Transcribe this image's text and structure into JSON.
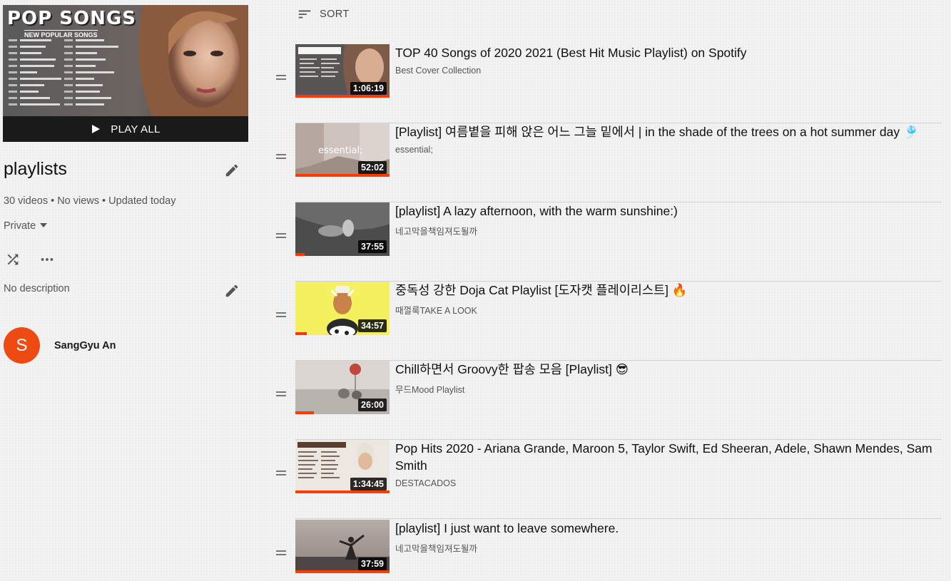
{
  "sidebar": {
    "hero": {
      "art_title": "POP SONGS",
      "art_subtitle": "NEW POPULAR SONGS",
      "play_all_label": "PLAY ALL"
    },
    "title": "playlists",
    "stats": "30 videos • No views • Updated today",
    "privacy": "Private",
    "description": "No description",
    "owner": {
      "initial": "S",
      "name": "SangGyu An",
      "avatar_color": "#ee4b13"
    }
  },
  "sort_label": "SORT",
  "videos": [
    {
      "title": "TOP 40 Songs of 2020 2021 (Best Hit Music Playlist) on Spotify",
      "channel": "Best Cover Collection",
      "duration": "1:06:19",
      "watched": 1.0
    },
    {
      "title": "[Playlist] 여름볕을 피해 앉은 어느 그늘 밑에서 | in the shade of the trees on a hot summer day 🎐",
      "channel": "essential;",
      "duration": "52:02",
      "watched": 1.0
    },
    {
      "title": "[playlist] A lazy afternoon, with the warm sunshine:)",
      "channel": "네고막을책임져도될까",
      "duration": "37:55",
      "watched": 0.1
    },
    {
      "title": "중독성 강한 Doja Cat Playlist [도자캣 플레이리스트] 🔥",
      "channel": "때껄룩TAKE A LOOK",
      "duration": "34:57",
      "watched": 0.12
    },
    {
      "title": "Chill하면서 Groovy한 팝송 모음 [Playlist] 😎",
      "channel": "무드Mood Playlist",
      "duration": "26:00",
      "watched": 0.2
    },
    {
      "title": "Pop Hits 2020 - Ariana Grande, Maroon 5, Taylor Swift, Ed Sheeran, Adele, Shawn Mendes, Sam Smith",
      "channel": "DESTACADOS",
      "duration": "1:34:45",
      "watched": 1.0
    },
    {
      "title": "[playlist] I just want to leave somewhere.",
      "channel": "네고막을책임져도될까",
      "duration": "37:59",
      "watched": 1.0
    }
  ],
  "colors": {
    "accent": "#ff3a00",
    "background": "#f2f2f2"
  }
}
